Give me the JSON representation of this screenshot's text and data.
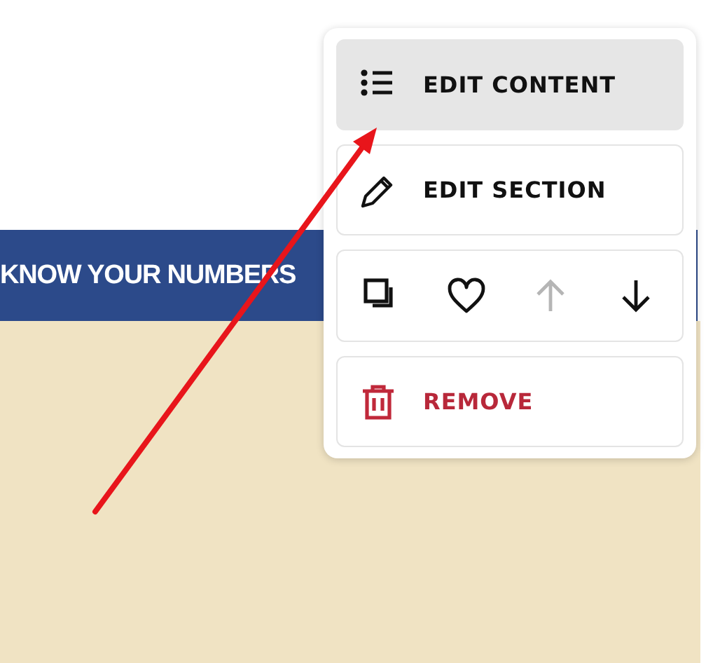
{
  "banner": {
    "title": "KNOW YOUR NUMBERS"
  },
  "menu": {
    "items": [
      {
        "kind": "action",
        "label": "EDIT CONTENT",
        "selected": true
      },
      {
        "kind": "action",
        "label": "EDIT SECTION",
        "selected": false
      },
      {
        "kind": "icons",
        "buttons": [
          {
            "disabled": false
          },
          {
            "disabled": false
          },
          {
            "disabled": true
          },
          {
            "disabled": false
          }
        ]
      },
      {
        "kind": "danger",
        "label": "REMOVE",
        "selected": false
      }
    ]
  }
}
